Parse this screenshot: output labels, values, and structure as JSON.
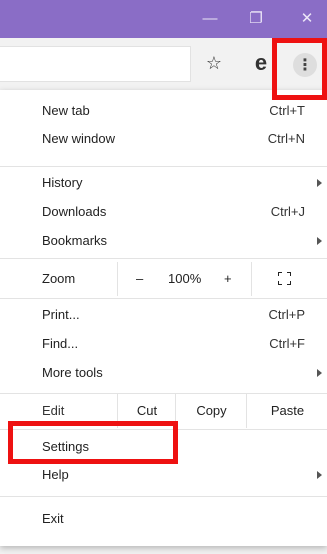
{
  "window": {
    "minimize": "—",
    "maximize": "❐",
    "close": "✕"
  },
  "toolbar": {
    "star": "☆",
    "profile": "e",
    "menu": "⋮"
  },
  "menu": {
    "new_tab": {
      "label": "New tab",
      "shortcut": "Ctrl+T"
    },
    "new_window": {
      "label": "New window",
      "shortcut": "Ctrl+N"
    },
    "history": {
      "label": "History"
    },
    "downloads": {
      "label": "Downloads",
      "shortcut": "Ctrl+J"
    },
    "bookmarks": {
      "label": "Bookmarks"
    },
    "zoom": {
      "label": "Zoom",
      "minus": "–",
      "value": "100%",
      "plus": "+"
    },
    "print": {
      "label": "Print...",
      "shortcut": "Ctrl+P"
    },
    "find": {
      "label": "Find...",
      "shortcut": "Ctrl+F"
    },
    "more_tools": {
      "label": "More tools"
    },
    "edit": {
      "label": "Edit",
      "cut": "Cut",
      "copy": "Copy",
      "paste": "Paste"
    },
    "settings": {
      "label": "Settings"
    },
    "help": {
      "label": "Help"
    },
    "exit": {
      "label": "Exit"
    }
  },
  "colors": {
    "titlebar": "#8a6dc6",
    "highlight": "#ee1111"
  }
}
